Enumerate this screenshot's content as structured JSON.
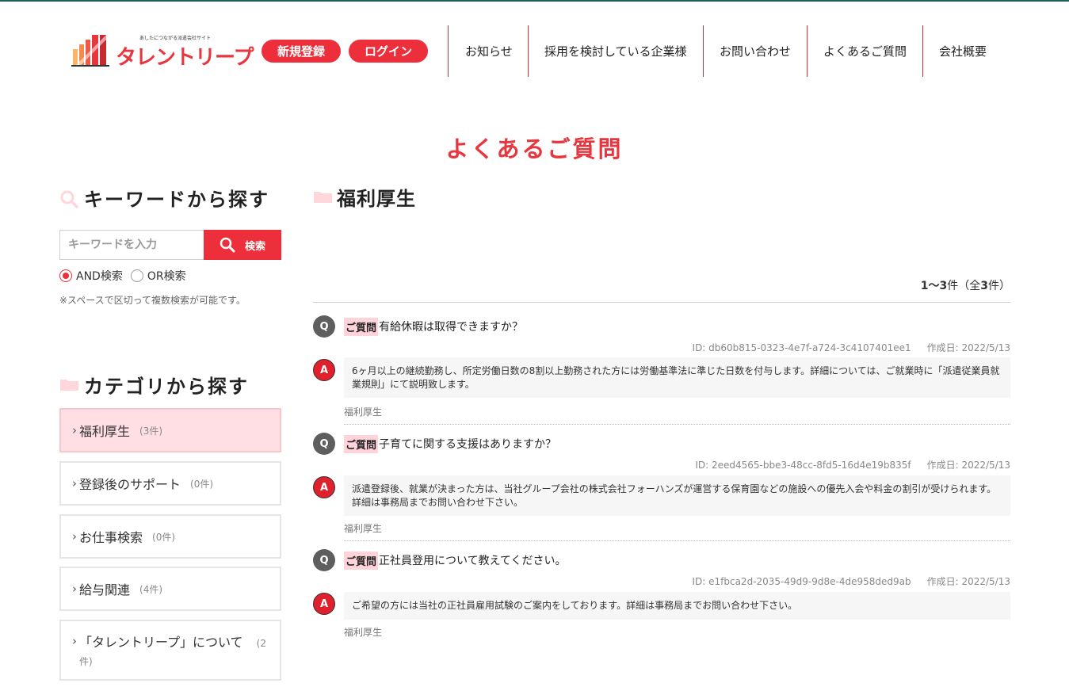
{
  "header": {
    "logo_tagline": "あしたにつながる派遣会社サイト",
    "logo_text": "タレントリープ",
    "register_label": "新規登録",
    "login_label": "ログイン",
    "nav": [
      {
        "label": "お知らせ"
      },
      {
        "label": "採用を検討している企業様"
      },
      {
        "label": "お問い合わせ"
      },
      {
        "label": "よくあるご質問"
      },
      {
        "label": "会社概要"
      }
    ]
  },
  "page_title": "よくあるご質問",
  "sidebar": {
    "keyword_heading": "キーワードから探す",
    "search_placeholder": "キーワードを入力",
    "search_button": "検索",
    "and_label": "AND検索",
    "or_label": "OR検索",
    "note": "※スペースで区切って複数検索が可能です。",
    "category_heading": "カテゴリから探す",
    "categories": [
      {
        "label": "福利厚生",
        "count": "(3件)"
      },
      {
        "label": "登録後のサポート",
        "count": "(0件)"
      },
      {
        "label": "お仕事検索",
        "count": "(0件)"
      },
      {
        "label": "給与関連",
        "count": "(4件)"
      },
      {
        "label": "「タレントリープ」について",
        "count": "(2件)"
      }
    ]
  },
  "main": {
    "section_title": "福利厚生",
    "count_text": {
      "range": "1〜3",
      "unit1": "件（全",
      "total": "3",
      "unit2": "件）"
    },
    "q_badge": "Q",
    "a_badge": "A",
    "q_tag": "ご質問",
    "items": [
      {
        "question": "有給休暇は取得できますか？",
        "id": "ID: db60b815-0323-4e7f-a724-3c4107401ee1",
        "created": "作成日: 2022/5/13",
        "answer": "6ヶ月以上の継続勤務し、所定労働日数の8割以上勤務された方には労働基準法に準じた日数を付与します。詳細については、ご就業時に「派遣従業員就業規則」にて説明致します。",
        "category": "福利厚生"
      },
      {
        "question": "子育てに関する支援はありますか？",
        "id": "ID: 2eed4565-bbe3-48cc-8fd5-16d4e19b835f",
        "created": "作成日: 2022/5/13",
        "answer": "派遣登録後、就業が決まった方は、当社グループ会社の株式会社フォーハンズが運営する保育園などの施設への優先入会や料金の割引が受けられます。詳細は事務局までお問い合わせ下さい。",
        "category": "福利厚生"
      },
      {
        "question": "正社員登用について教えてください。",
        "id": "ID: e1fbca2d-2035-49d9-9d8e-4de958ded9ab",
        "created": "作成日: 2022/5/13",
        "answer": "ご希望の方には当社の正社員雇用試験のご案内をしております。詳細は事務局までお問い合わせ下さい。",
        "category": "福利厚生"
      }
    ]
  },
  "colors": {
    "accent": "#ec2f3b",
    "accent_light": "#ffdfe4",
    "q_badge": "#5e5e5e"
  }
}
